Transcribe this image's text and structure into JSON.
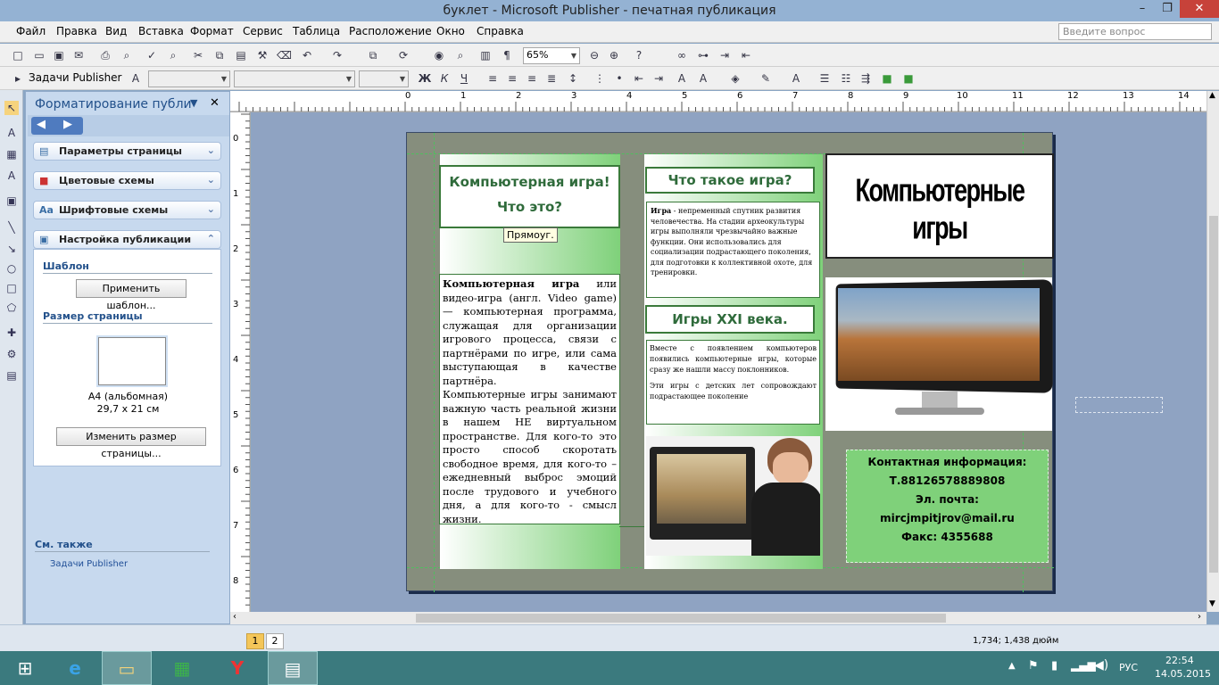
{
  "window": {
    "title": "буклет - Microsoft Publisher - печатная публикация"
  },
  "menu": [
    "Файл",
    "Правка",
    "Вид",
    "Вставка",
    "Формат",
    "Сервис",
    "Таблица",
    "Расположение",
    "Окно",
    "Справка"
  ],
  "ask_placeholder": "Введите вопрос",
  "toolbar": {
    "zoom": "65%",
    "tasks_label": "Задачи Publisher",
    "bold": "Ж",
    "italic": "К",
    "underline": "Ч"
  },
  "taskpane": {
    "title": "Форматирование публи",
    "sections": [
      "Параметры страницы",
      "Цветовые схемы",
      "Шрифтовые схемы",
      "Настройка публикации"
    ],
    "template_label": "Шаблон",
    "apply_template_btn": "Применить шаблон...",
    "page_size_label": "Размер страницы",
    "page_name": "A4 (альбомная)",
    "page_dims": "29,7 x 21 см",
    "resize_btn": "Изменить размер страницы...",
    "see_also": "См. также",
    "link_tasks": "Задачи Publisher"
  },
  "ruler": {
    "h": [
      "1",
      "2",
      "3",
      "4",
      "5",
      "6",
      "7",
      "8",
      "9",
      "10",
      "11",
      "12",
      "13",
      "14"
    ],
    "h_left": "0",
    "v": [
      "0",
      "1",
      "2",
      "3",
      "4",
      "5",
      "6",
      "7",
      "8"
    ]
  },
  "doc": {
    "col1_head1": "Компьютерная игра!",
    "col1_head2": "Что это?",
    "tooltip": "Прямоуг.",
    "col1_body_bold": "Компьютерная игра",
    "col1_body_p1": " или видео-игра (англ. Video game) — компьютерная программа, служащая для организации игрового процесса, связи с партнёрами по игре, или сама выступающая в качестве партнёра.",
    "col1_body_p2": "Компьютерные игры занимают важную часть реальной жизни в нашем НЕ виртуальном пространстве. Для кого-то это просто способ скоротать свободное время, для кого-то – ежедневный выброс эмоций после трудового и учебного дня, а для кого-то - смысл жизни.",
    "col2_head1": "Что такое игра?",
    "col2_body1_bold": "Игра",
    "col2_body1": " - непременный спутник развития человечества. На стадии археокультуры игры выполняли чрезвычайно важные функции. Они использовались для социализации подрастающего поколения, для подготовки к коллективной охоте, для тренировки.",
    "col2_head2": "Игры XXI века.",
    "col2_body2_p1": "Вместе с появлением компьютеров появились компьютерные игры, которые сразу же нашли массу поклонников.",
    "col2_body2_p2": "Эти игры с детских лет сопровождают подрастающее поколение",
    "col3_wordart": "Компьютерные игры",
    "contact_title": "Контактная информация:",
    "contact_phone": "Т.88126578889808",
    "contact_email": "Эл. почта: mircjmpitjrov@mail.ru",
    "contact_fax": "Факс: 4355688"
  },
  "status": {
    "page1": "1",
    "page2": "2",
    "coords": "1,734; 1,438 дюйм"
  },
  "taskbar": {
    "lang": "РУС",
    "time": "22:54",
    "date": "14.05.2015"
  },
  "colors": {
    "accent_green": "#7fd17a",
    "heading_text": "#2f6b3b",
    "page_bg": "#868e7d",
    "workspace": "#8fa3c2"
  }
}
